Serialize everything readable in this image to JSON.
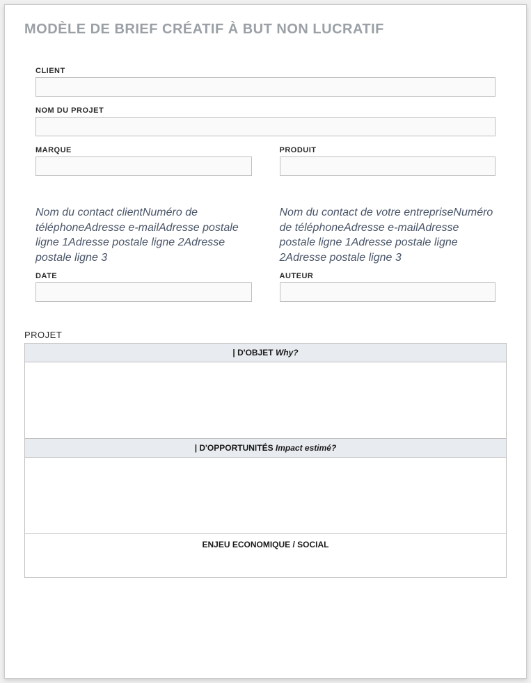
{
  "title": "MODÈLE DE BRIEF CRÉATIF À BUT NON LUCRATIF",
  "fields": {
    "client_label": "CLIENT",
    "client_value": "",
    "project_name_label": "NOM DU PROJET",
    "project_name_value": "",
    "brand_label": "MARQUE",
    "brand_value": "",
    "product_label": "PRODUIT",
    "product_value": "",
    "date_label": "DATE",
    "date_value": "",
    "author_label": "AUTEUR",
    "author_value": ""
  },
  "contacts": {
    "client_contact": "Nom du contact clientNuméro de téléphoneAdresse e-mailAdresse postale ligne 1Adresse postale ligne 2Adresse postale ligne 3",
    "company_contact": "Nom du contact de votre entrepriseNuméro de téléphoneAdresse e-mailAdresse postale ligne 1Adresse postale ligne 2Adresse postale ligne 3"
  },
  "project_section": {
    "heading": "PROJET",
    "rows": [
      {
        "label_prefix": "| D'OBJET  ",
        "label_italic": "Why?",
        "value": ""
      },
      {
        "label_prefix": "| D'OPPORTUNITÉS  ",
        "label_italic": "Impact estimé?",
        "value": ""
      }
    ],
    "footer_label": "ENJEU ECONOMIQUE / SOCIAL"
  }
}
